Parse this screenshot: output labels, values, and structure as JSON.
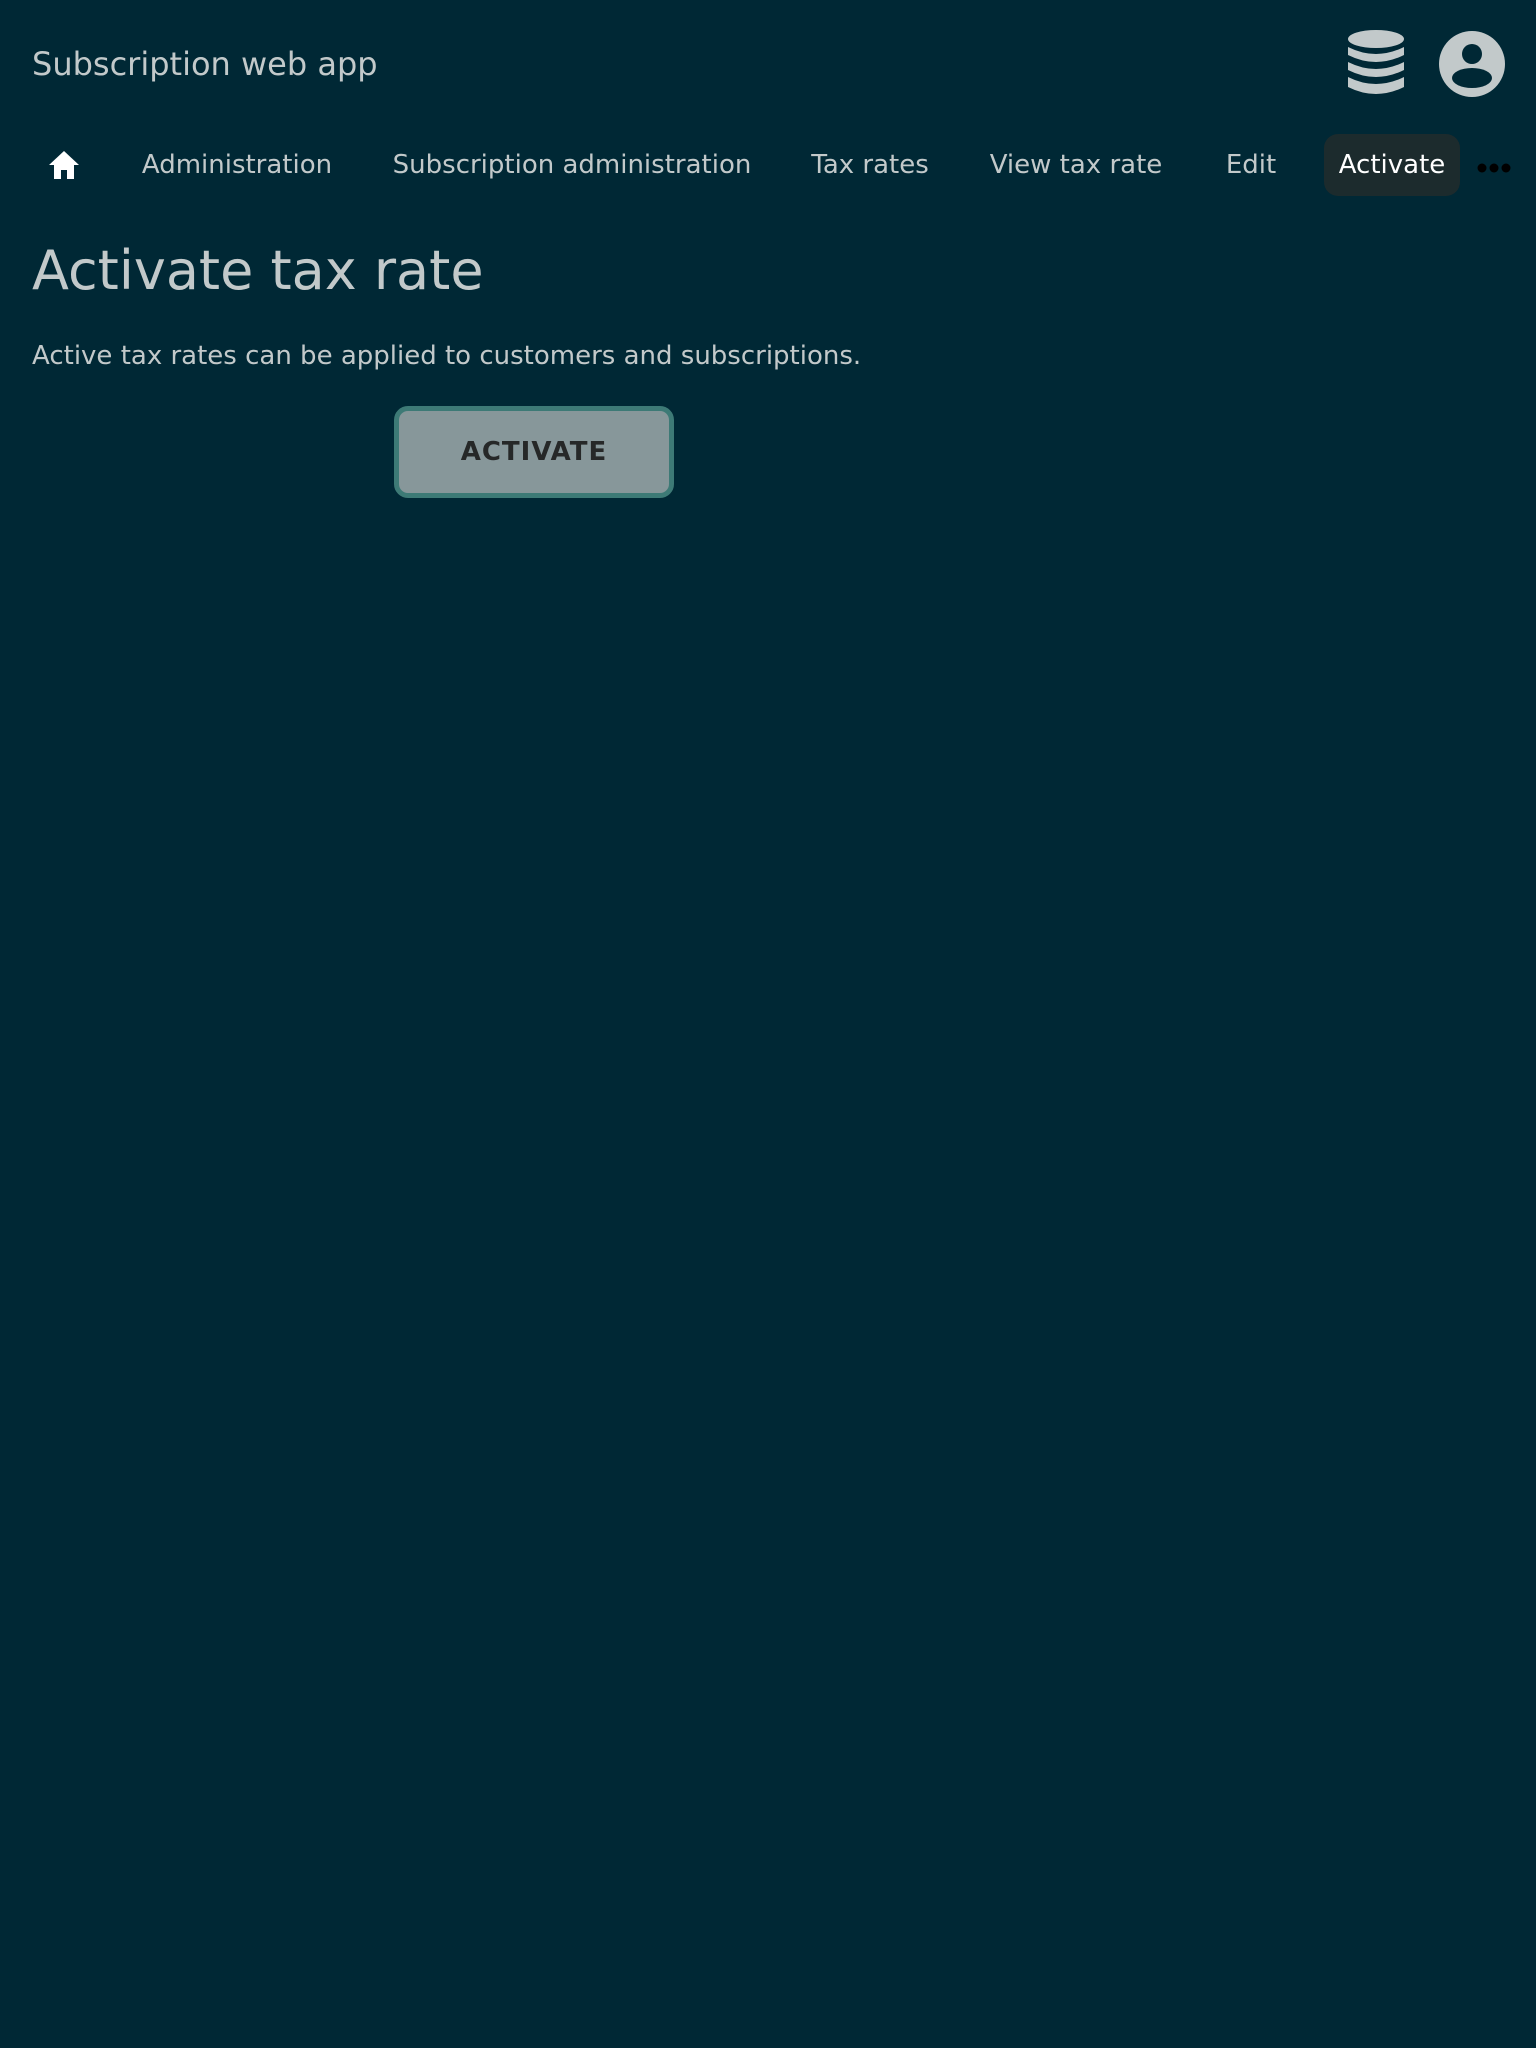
{
  "app": {
    "title": "Subscription web app"
  },
  "header_icons": {
    "database_icon": "database-icon",
    "account_icon": "account-circle-icon",
    "icon_color": "#c2c9ca"
  },
  "breadcrumbs": {
    "home_icon": "home-icon",
    "items": [
      "Administration",
      "Subscription administration",
      "Tax rates",
      "View tax rate",
      "Edit",
      "Activate"
    ],
    "more_icon": "more-horizontal-icon"
  },
  "main": {
    "title": "Activate tax rate",
    "description": "Active tax rates can be applied to customers and subscriptions.",
    "activate_button_label": "ACTIVATE"
  },
  "colors": {
    "background": "#002835",
    "text": "#c2c9ca",
    "active_tab_background": "#1c2b2d",
    "button_background": "#87979a",
    "button_border": "#3d7a76"
  }
}
